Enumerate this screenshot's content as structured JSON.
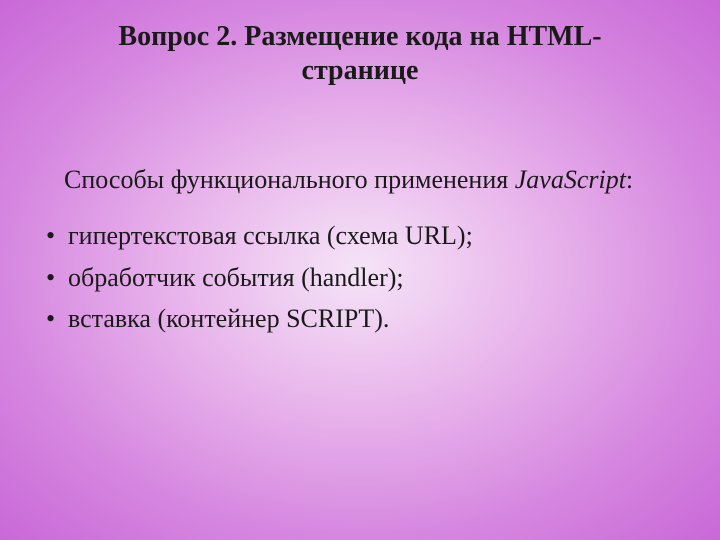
{
  "title": "Вопрос 2. Размещение кода на HTML-странице",
  "intro_prefix": "Способы функционального применения ",
  "intro_italic": "JavaScript",
  "intro_suffix": ":",
  "bullets": {
    "b0": "гипертекстовая ссылка (схема URL);",
    "b1": "обработчик события (handler);",
    "b2": "вставка (контейнер SCRIPT)."
  }
}
